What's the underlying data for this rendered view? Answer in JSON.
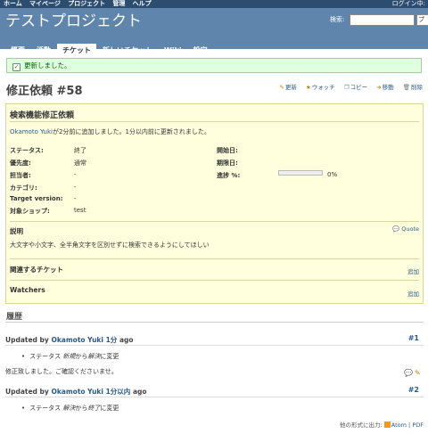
{
  "top_menu": {
    "items": [
      "ホーム",
      "マイページ",
      "プロジェクト",
      "管理",
      "ヘルプ"
    ],
    "login": "ログイン中:"
  },
  "header": {
    "project_title": "テストプロジェクト",
    "search_label": "検索:",
    "search_value": "",
    "project_select": "プロ"
  },
  "main_menu": {
    "tabs": [
      "概要",
      "活動",
      "チケット",
      "新しいチケット",
      "Wiki",
      "設定"
    ],
    "selected": "チケット"
  },
  "flash": {
    "message": "更新しました。"
  },
  "issue": {
    "title": "修正依頼 #58",
    "subject": "検索機能修正依頼",
    "author_name": "Okamoto Yuki",
    "author_suffix": "が2分前に追加しました。1分以内前に更新されました。",
    "attributes_left": [
      {
        "label": "ステータス:",
        "value": "終了"
      },
      {
        "label": "優先度:",
        "value": "通常"
      },
      {
        "label": "担当者:",
        "value": "-"
      },
      {
        "label": "カテゴリ:",
        "value": "-"
      },
      {
        "label": "Target version:",
        "value": "-"
      },
      {
        "label": "対象ショップ:",
        "value": "test"
      }
    ],
    "attributes_right": [
      {
        "label": "開始日:",
        "value": ""
      },
      {
        "label": "期限日:",
        "value": ""
      },
      {
        "label": "進捗 %:",
        "value": "0%"
      }
    ],
    "progress_fraction": 0,
    "description_title": "説明",
    "quote_label": "Quote",
    "description": "大文字や小文字、全半角文字を区別せずに検索できるようにしてほしい",
    "related_title": "関連するチケット",
    "related_add": "追加",
    "watchers_title": "Watchers",
    "watchers_add": "追加"
  },
  "contextual": {
    "update": "更新",
    "watch": "ウォッチ",
    "copy": "コピー",
    "move": "移動",
    "delete": "削除"
  },
  "history": {
    "title": "履歴",
    "journals": [
      {
        "prefix": "Updated by",
        "user": "Okamoto Yuki",
        "time": "1分",
        "suffix": "ago",
        "number": "#1",
        "detail_pre": "ステータス",
        "detail_from": "新規",
        "detail_mid": "から",
        "detail_to": "解決",
        "detail_post": "に変更",
        "notes": "修正致しました。ご確認くださいませ。"
      },
      {
        "prefix": "Updated by",
        "user": "Okamoto Yuki",
        "time": "1分以内",
        "suffix": "ago",
        "number": "#2",
        "detail_pre": "ステータス",
        "detail_from": "解決",
        "detail_mid": "から",
        "detail_to": "終了",
        "detail_post": "に変更",
        "notes": ""
      }
    ]
  },
  "footer": {
    "other_formats": "他の形式に出力:",
    "atom": "Atom",
    "separator": "|",
    "pdf": "PDF"
  }
}
